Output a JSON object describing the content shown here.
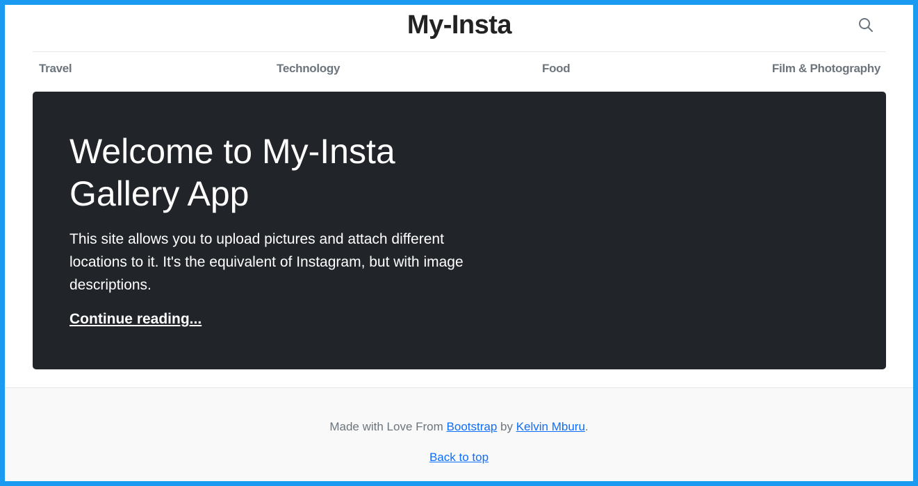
{
  "header": {
    "title": "My-Insta",
    "search_icon": "search-icon"
  },
  "nav": {
    "items": [
      {
        "label": "Travel"
      },
      {
        "label": "Technology"
      },
      {
        "label": "Food"
      },
      {
        "label": "Film & Photography"
      }
    ]
  },
  "hero": {
    "title": "Welcome to My-Insta Gallery App",
    "text": "This site allows you to upload pictures and attach different locations to it. It's the equivalent of Instagram, but with image descriptions.",
    "link": "Continue reading..."
  },
  "footer": {
    "prefix": "Made with Love From ",
    "bootstrap_link": "Bootstrap",
    "by": " by ",
    "author_link": "Kelvin Mburu",
    "suffix": ".",
    "back_to_top": "Back to top"
  },
  "colors": {
    "hero_background": "#212429",
    "link": "#0d6efd",
    "nav_text": "#6c757d",
    "frame_border": "#1a9af0"
  }
}
